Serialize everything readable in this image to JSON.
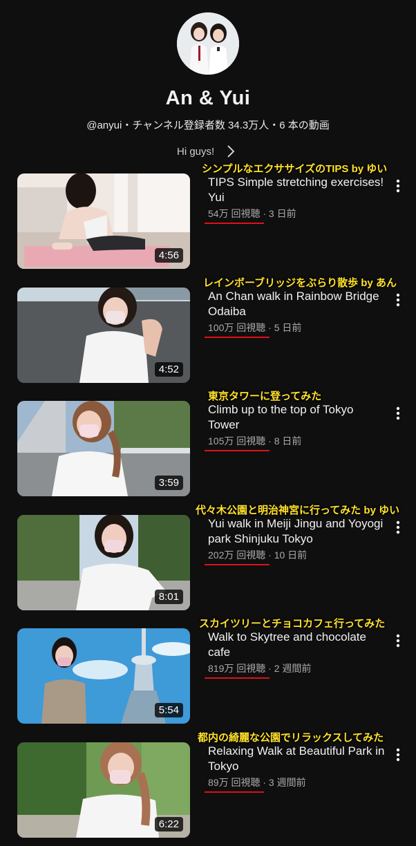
{
  "channel": {
    "name": "An & Yui",
    "meta": "@anyui・チャンネル登録者数 34.3万人・6 本の動画",
    "about_text": "Hi guys!"
  },
  "videos": [
    {
      "caption": "シンプルなエクササイズのTIPS by ゆい",
      "title": "TIPS Simple stretching exercises! Yui",
      "views": "54万 回視聴",
      "age": " · 3 日前",
      "duration": "4:56"
    },
    {
      "caption": "レインボーブリッジをぶらり散歩 by あん",
      "title": "An Chan walk in Rainbow Bridge Odaiba",
      "views": "100万 回視聴",
      "age": " · 5 日前",
      "duration": "4:52"
    },
    {
      "caption": "東京タワーに登ってみた",
      "title": "Climb up to the top of Tokyo Tower",
      "views": "105万 回視聴",
      "age": " · 8 日前",
      "duration": "3:59"
    },
    {
      "caption": "代々木公園と明治神宮に行ってみた by ゆい",
      "title": "Yui walk in Meiji Jingu and Yoyogi park Shinjuku Tokyo",
      "views": "202万 回視聴",
      "age": " · 10 日前",
      "duration": "8:01"
    },
    {
      "caption": "スカイツリーとチョコカフェ行ってみた",
      "title": "Walk to Skytree and chocolate cafe",
      "views": "819万 回視聴",
      "age": " · 2 週間前",
      "duration": "5:54"
    },
    {
      "caption": "都内の綺麗な公園でリラックスしてみた",
      "title": "Relaxing Walk at Beautiful Park in Tokyo",
      "views": "89万 回視聴",
      "age": " · 3 週間前",
      "duration": "6:22"
    }
  ],
  "colors": {
    "background": "#0f0f0f",
    "caption": "#ffe12a",
    "underline": "#e0101a",
    "meta_text": "#aaaaaa"
  },
  "icons": {
    "about": "chevron-right-icon",
    "menu": "more-vert-icon"
  }
}
